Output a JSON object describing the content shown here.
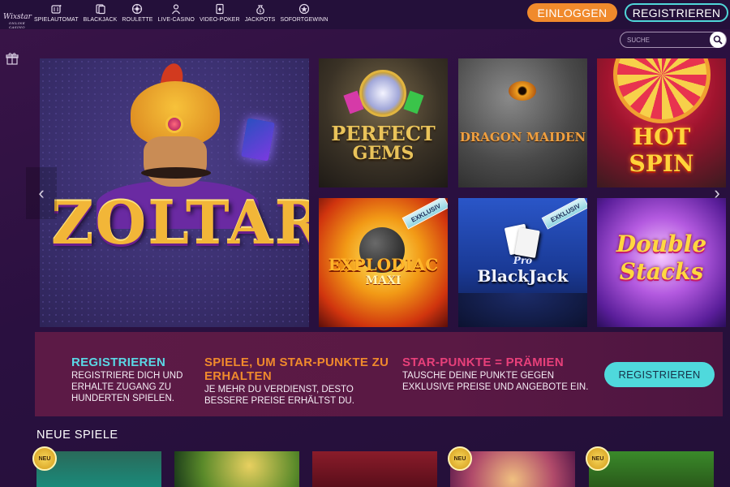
{
  "header": {
    "logo": {
      "name": "Wixstar",
      "tagline": "ONLINE CASINO"
    },
    "nav": [
      {
        "label": "SPIELAUTOMAT",
        "icon": "slot-machine-icon"
      },
      {
        "label": "BLACKJACK",
        "icon": "cards-icon"
      },
      {
        "label": "ROULETTE",
        "icon": "roulette-icon"
      },
      {
        "label": "LIVE-CASINO",
        "icon": "dealer-icon"
      },
      {
        "label": "VIDEO-POKER",
        "icon": "poker-card-icon"
      },
      {
        "label": "JACKPOTS",
        "icon": "money-bag-icon"
      },
      {
        "label": "SOFORTGEWINN",
        "icon": "instant-win-icon"
      }
    ],
    "login_label": "EINLOGGEN",
    "register_label": "REGISTRIEREN",
    "search_placeholder": "SUCHE"
  },
  "hero": {
    "title": "ZOLTAR"
  },
  "games": [
    {
      "title_line1": "PERFECT",
      "title_line2": "GEMS",
      "badge": ""
    },
    {
      "title_line1": "DRAGON",
      "title_line2": "MAIDEN",
      "badge": ""
    },
    {
      "title_line1": "HOT SPIN",
      "title_line2": "",
      "badge": ""
    },
    {
      "title_line1": "EXPLODIAC",
      "title_line2": "MAXI",
      "badge": "EXKLUSIV"
    },
    {
      "title_line1": "Pro",
      "title_line2": "BlackJack",
      "badge": "EXKLUSIV"
    },
    {
      "title_line1": "Double",
      "title_line2": "Stacks",
      "badge": ""
    }
  ],
  "promo": {
    "col1": {
      "heading": "REGISTRIEREN",
      "text": "REGISTRIERE DICH UND ERHALTE ZUGANG ZU HUNDERTEN SPIELEN."
    },
    "col2": {
      "heading": "SPIELE, UM STAR-PUNKTE ZU ERHALTEN",
      "text": "JE MEHR DU VERDIENST, DESTO BESSERE PREISE ERHÄLTST DU."
    },
    "col3": {
      "heading": "STAR-PUNKTE = PRÄMIEN",
      "text": "TAUSCHE DEINE PUNKTE GEGEN EXKLUSIVE PREISE UND ANGEBOTE EIN."
    },
    "button_label": "REGISTRIEREN"
  },
  "new_games": {
    "title": "NEUE SPIELE",
    "badge": "NEU"
  },
  "colors": {
    "accent_orange": "#f08a2c",
    "accent_cyan": "#4fd6d8",
    "heading_cyan": "#5ad8e6",
    "heading_orange": "#f08a2c",
    "heading_pink": "#e8407a",
    "background": "#2a1040"
  }
}
